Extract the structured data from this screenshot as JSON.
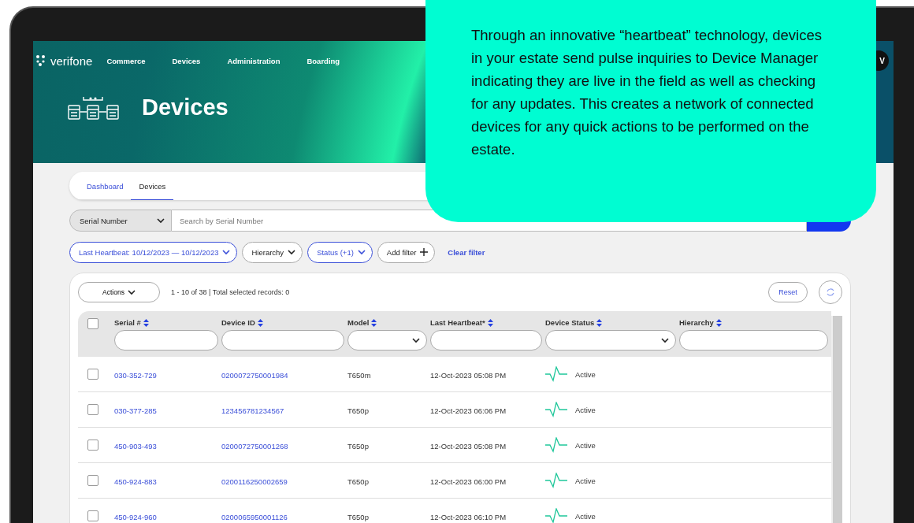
{
  "callout": {
    "text": "Through an innovative “heartbeat” technology, devices in your estate send pulse inquiries to Device Manager indicating they are live in the field as well as checking for any updates. This creates a network of connected devices for any quick actions to be performed on the estate."
  },
  "app": {
    "logo": "verifone",
    "nav": [
      "Commerce",
      "Devices",
      "Administration",
      "Boarding"
    ],
    "avatar": "V"
  },
  "page_title": "Devices",
  "tabs": [
    {
      "label": "Dashboard",
      "selected": false
    },
    {
      "label": "Devices",
      "selected": true
    }
  ],
  "search": {
    "field": "Serial Number",
    "placeholder": "Search by Serial Number"
  },
  "filters": [
    {
      "label": "Last Heartbeat: 10/12/2023 — 10/12/2023",
      "active": true,
      "kind": "dropdown"
    },
    {
      "label": "Hierarchy",
      "active": false,
      "kind": "dropdown"
    },
    {
      "label": "Status (+1)",
      "active": true,
      "kind": "dropdown"
    },
    {
      "label": "Add filter",
      "active": false,
      "kind": "add"
    }
  ],
  "clear_filter": "Clear filter",
  "toolbar": {
    "actions": "Actions",
    "summary": "1 - 10 of 38 | Total selected records: 0",
    "reset": "Reset"
  },
  "table": {
    "all_checked": false,
    "columns": [
      {
        "label": "Serial #",
        "kind": "text"
      },
      {
        "label": "Device ID",
        "kind": "text"
      },
      {
        "label": "Model",
        "kind": "select"
      },
      {
        "label": "Last Heartbeat*",
        "kind": "text"
      },
      {
        "label": "Device Status",
        "kind": "select"
      },
      {
        "label": "Hierarchy",
        "kind": "text"
      }
    ],
    "rows": [
      {
        "checked": false,
        "serial": "030-352-729",
        "device_id": "0200072750001984",
        "model": "T650m",
        "last_heartbeat": "12-Oct-2023 05:08 PM",
        "status": "Active"
      },
      {
        "checked": false,
        "serial": "030-377-285",
        "device_id": "123456781234567",
        "model": "T650p",
        "last_heartbeat": "12-Oct-2023 06:06 PM",
        "status": "Active"
      },
      {
        "checked": false,
        "serial": "450-903-493",
        "device_id": "0200072750001268",
        "model": "T650p",
        "last_heartbeat": "12-Oct-2023 05:08 PM",
        "status": "Active"
      },
      {
        "checked": false,
        "serial": "450-924-883",
        "device_id": "0200116250002659",
        "model": "T650p",
        "last_heartbeat": "12-Oct-2023 06:00 PM",
        "status": "Active"
      },
      {
        "checked": false,
        "serial": "450-924-960",
        "device_id": "0200065950001126",
        "model": "T650p",
        "last_heartbeat": "12-Oct-2023 06:10 PM",
        "status": "Active"
      }
    ]
  }
}
